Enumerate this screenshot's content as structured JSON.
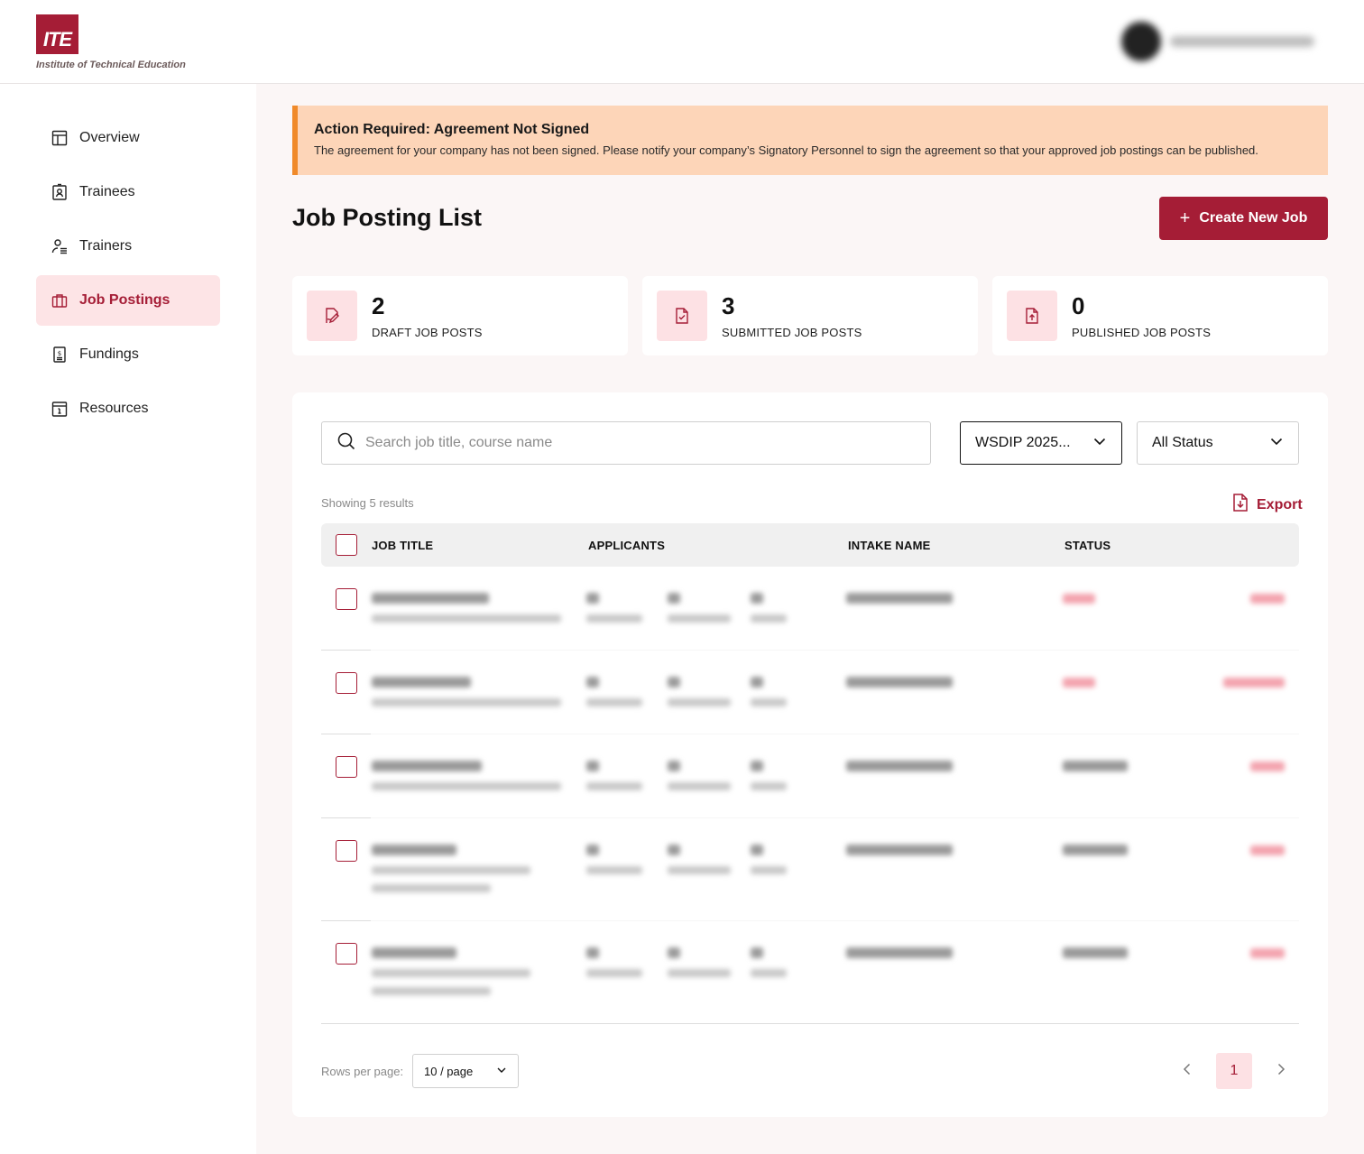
{
  "header": {
    "logo_mark": "ITE",
    "logo_text": "Institute of Technical Education"
  },
  "sidebar": {
    "items": [
      {
        "label": "Overview",
        "icon": "layout-icon"
      },
      {
        "label": "Trainees",
        "icon": "id-card-icon"
      },
      {
        "label": "Trainers",
        "icon": "user-list-icon"
      },
      {
        "label": "Job Postings",
        "icon": "briefcase-icon",
        "active": true
      },
      {
        "label": "Fundings",
        "icon": "money-receipt-icon"
      },
      {
        "label": "Resources",
        "icon": "info-calendar-icon"
      }
    ]
  },
  "alert": {
    "title": "Action Required: Agreement Not Signed",
    "message": "The agreement for your company has not been signed. Please notify your company’s Signatory Personnel to sign the agreement so that your approved job postings can be published."
  },
  "page": {
    "title": "Job Posting List",
    "create_button": "Create New Job"
  },
  "stats": [
    {
      "value": "2",
      "label": "DRAFT JOB POSTS",
      "icon": "edit-document-icon"
    },
    {
      "value": "3",
      "label": "SUBMITTED JOB POSTS",
      "icon": "check-document-icon"
    },
    {
      "value": "0",
      "label": "PUBLISHED JOB POSTS",
      "icon": "upload-document-icon"
    }
  ],
  "filters": {
    "search_placeholder": "Search job title, course name",
    "intake_selected": "WSDIP 2025...",
    "status_selected": "All Status"
  },
  "results_text": "Showing 5 results",
  "export_label": "Export",
  "table": {
    "columns": [
      "JOB TITLE",
      "APPLICANTS",
      "INTAKE NAME",
      "STATUS"
    ]
  },
  "pagination": {
    "rows_label": "Rows per page:",
    "page_size": "10 / page",
    "current_page": "1"
  },
  "colors": {
    "brand": "#a51d36",
    "alert_bg": "#fdd5b8",
    "alert_border": "#f08a2a",
    "active_nav_bg": "#fde4e6"
  }
}
